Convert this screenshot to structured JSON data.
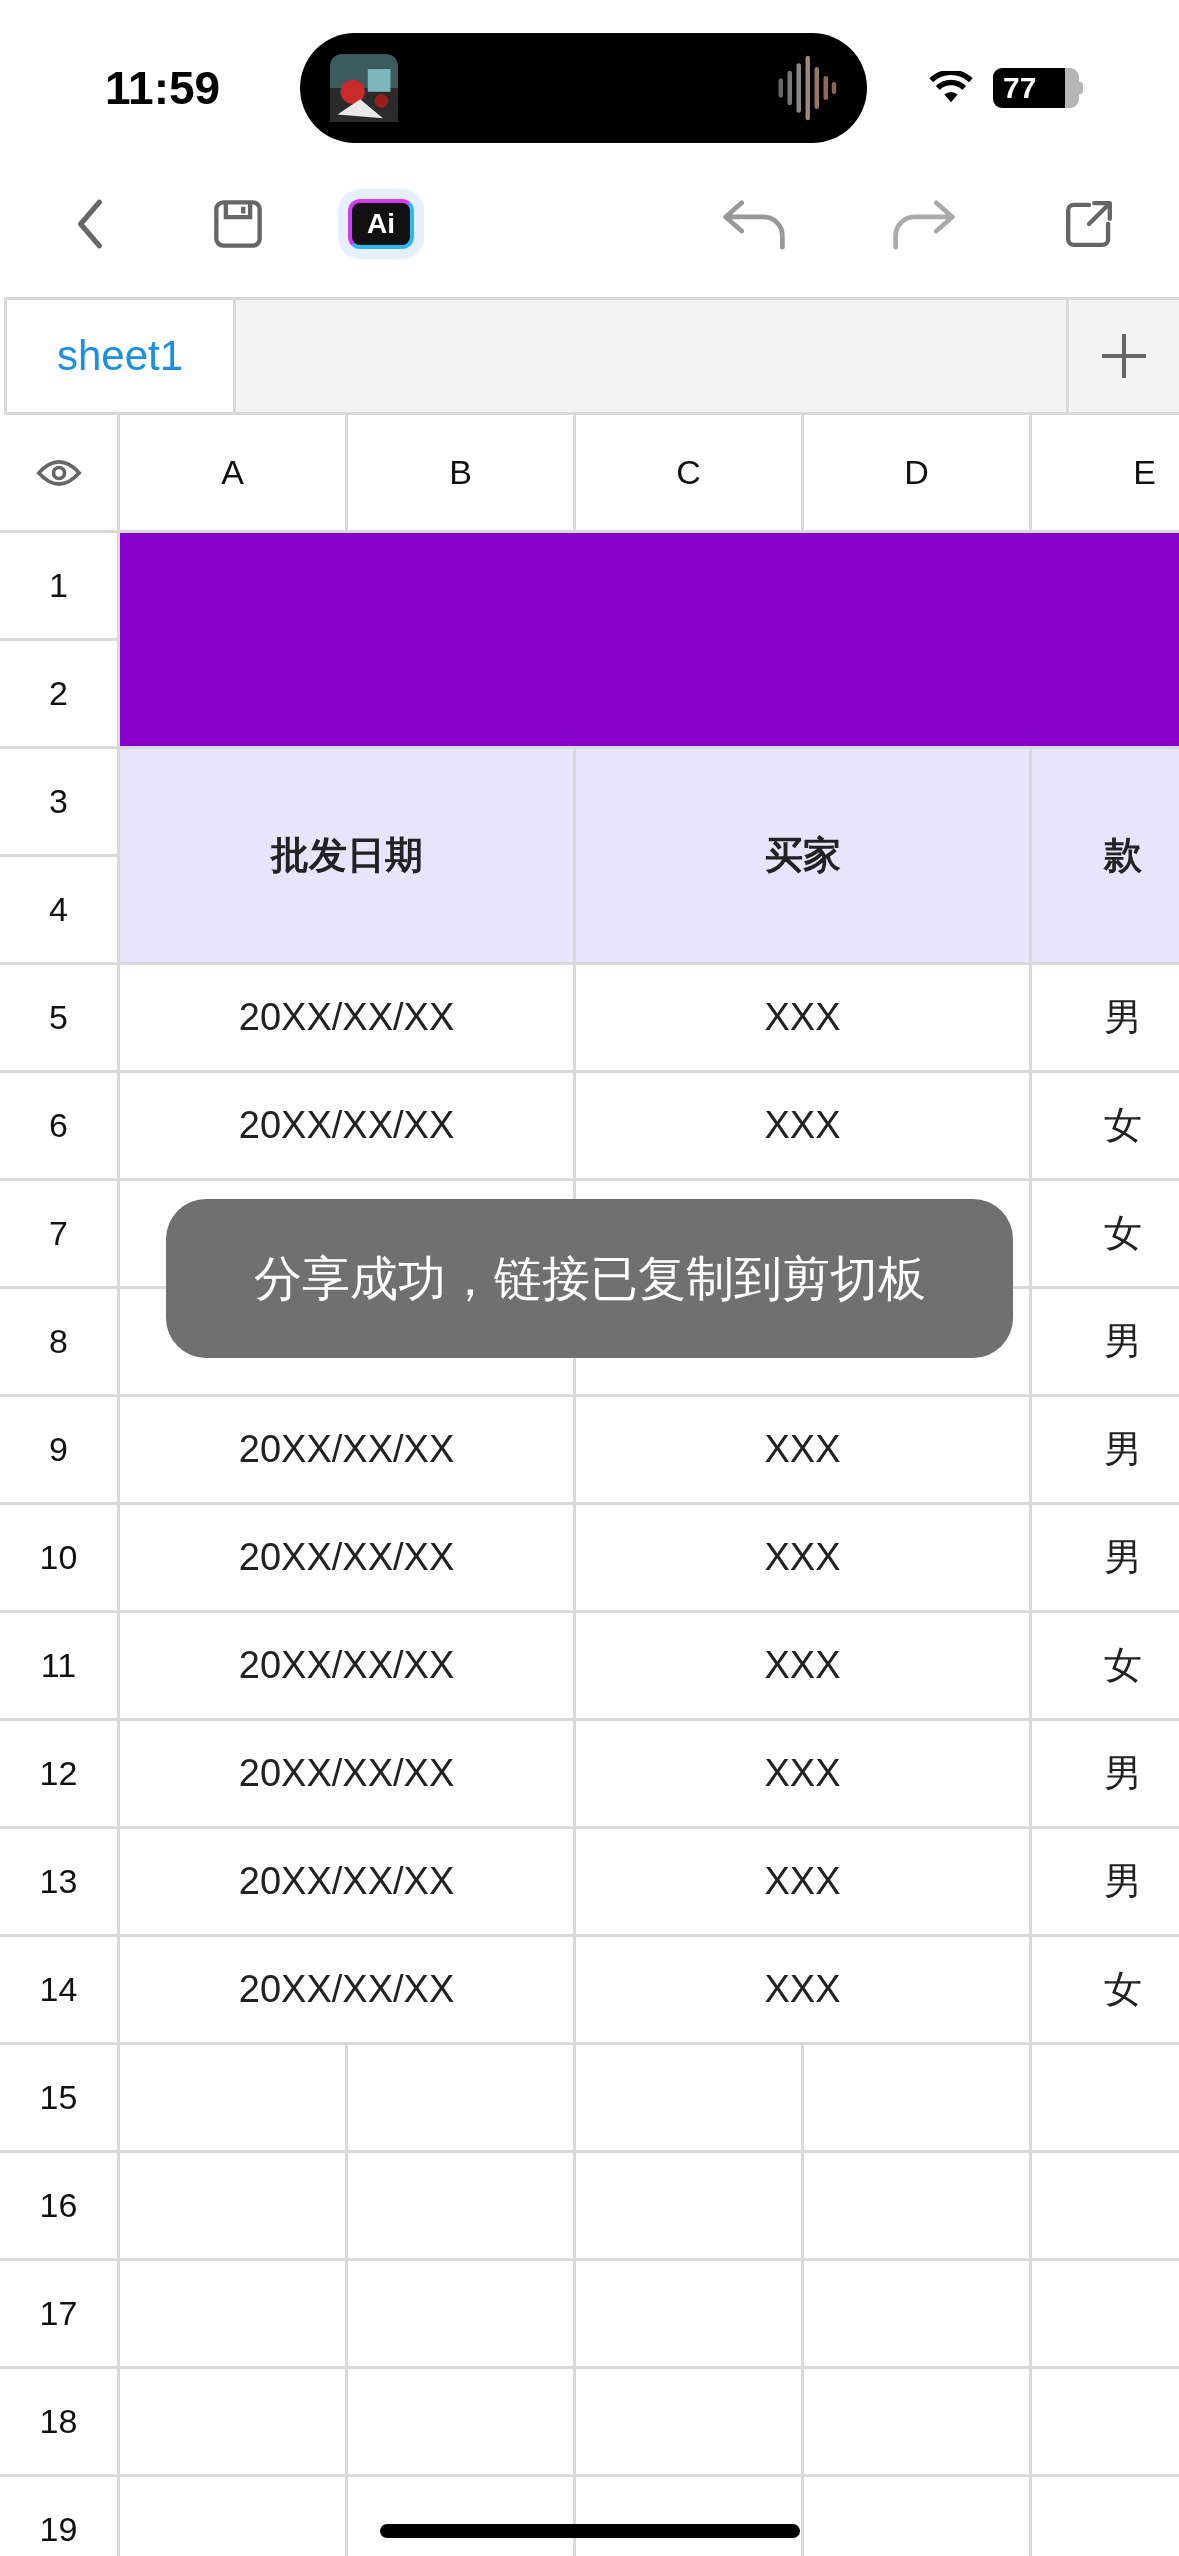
{
  "status_bar": {
    "time": "11:59",
    "battery": "77"
  },
  "toolbar": {
    "ai_label": "Ai"
  },
  "sheet_tabs": [
    {
      "label": "sheet1",
      "selected": true
    }
  ],
  "columns": [
    "A",
    "B",
    "C",
    "D",
    "E"
  ],
  "row_numbers": [
    "1",
    "2",
    "3",
    "4",
    "5",
    "6",
    "7",
    "8",
    "9",
    "10",
    "11",
    "12",
    "13",
    "14",
    "15",
    "16",
    "17",
    "18",
    "19"
  ],
  "header": [
    "批发日期",
    "买家",
    "款"
  ],
  "records": [
    {
      "date": "20XX/XX/XX",
      "buyer": "XXX",
      "style": "男"
    },
    {
      "date": "20XX/XX/XX",
      "buyer": "XXX",
      "style": "女"
    },
    {
      "style": "女"
    },
    {
      "style": "男"
    },
    {
      "date": "20XX/XX/XX",
      "buyer": "XXX",
      "style": "男"
    },
    {
      "date": "20XX/XX/XX",
      "buyer": "XXX",
      "style": "男"
    },
    {
      "date": "20XX/XX/XX",
      "buyer": "XXX",
      "style": "女"
    },
    {
      "date": "20XX/XX/XX",
      "buyer": "XXX",
      "style": "男"
    },
    {
      "date": "20XX/XX/XX",
      "buyer": "XXX",
      "style": "男"
    },
    {
      "date": "20XX/XX/XX",
      "buyer": "XXX",
      "style": "女"
    }
  ],
  "toast": "分享成功，链接已复制到剪切板"
}
